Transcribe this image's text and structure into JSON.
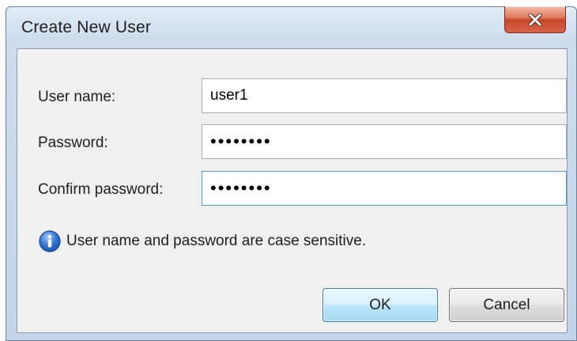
{
  "window": {
    "title": "Create New User",
    "close_icon": "close-icon"
  },
  "form": {
    "username_label": "User name:",
    "username_value": "user1",
    "password_label": "Password:",
    "password_value": "••••••••",
    "confirm_label": "Confirm password:",
    "confirm_value": "••••••••"
  },
  "info": {
    "icon": "info-icon",
    "text": "User name and password are case sensitive."
  },
  "buttons": {
    "ok_label": "OK",
    "cancel_label": "Cancel"
  },
  "colors": {
    "accent": "#3c7fb1",
    "close": "#c7452a",
    "info_icon": "#1f5fbf"
  }
}
